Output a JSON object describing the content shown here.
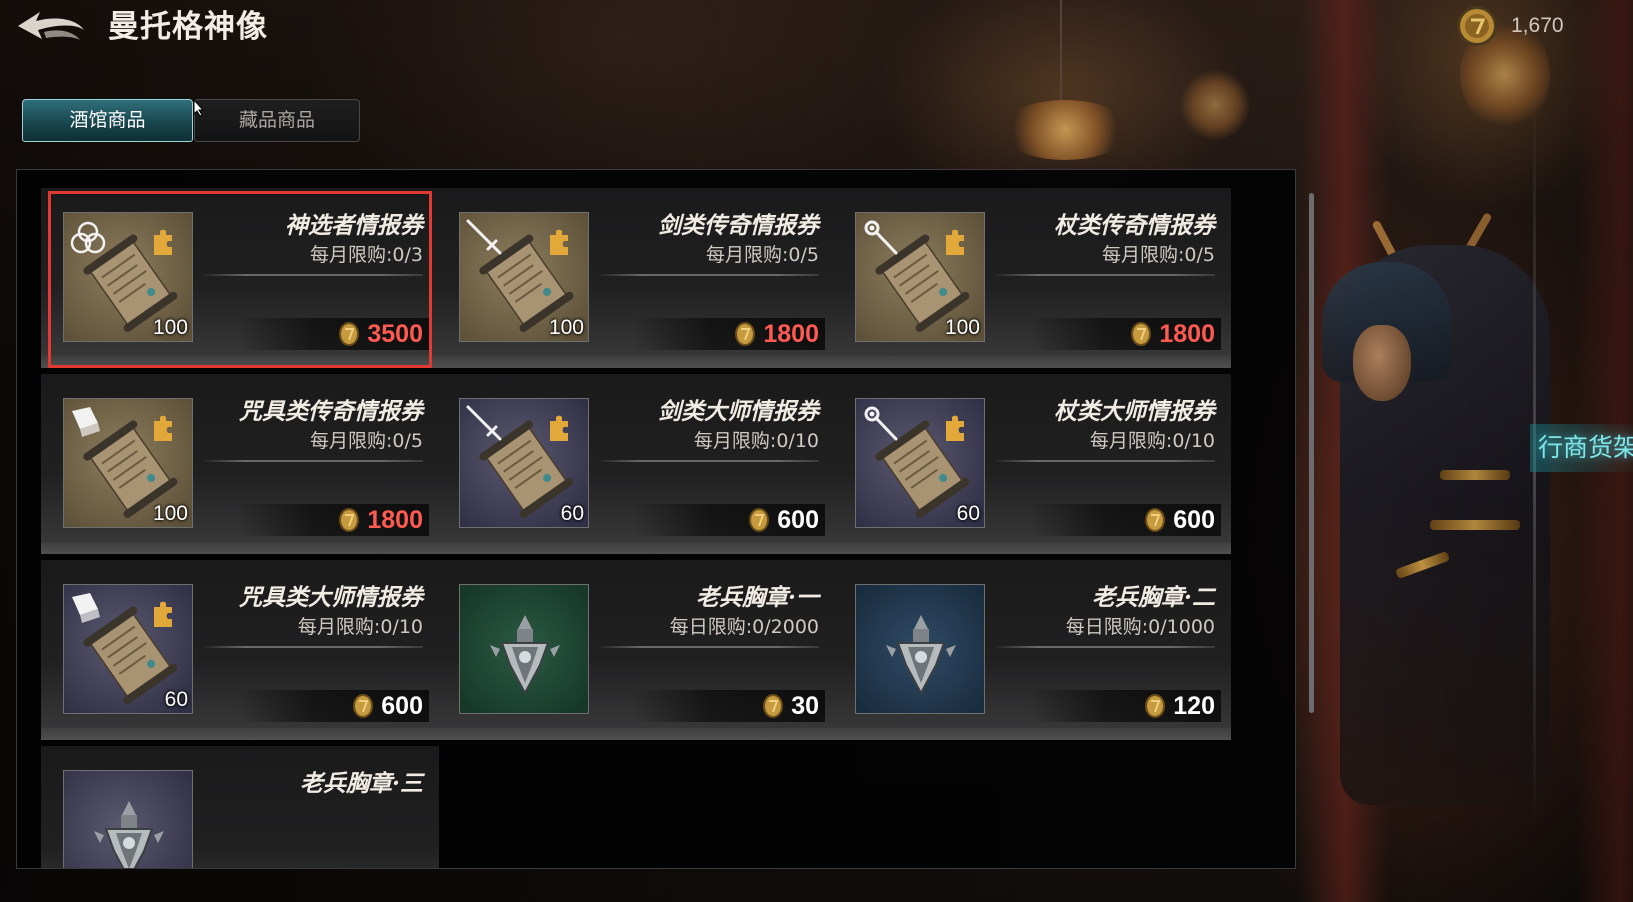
{
  "header": {
    "title": "曼托格神像",
    "back_icon": "back-arrow-icon",
    "currency_icon": "gold-coin-icon",
    "currency_amount": "1,670"
  },
  "tabs": [
    {
      "label": "酒馆商品",
      "active": true
    },
    {
      "label": "藏品商品",
      "active": false
    }
  ],
  "side_label": "行商货架",
  "accent_colors": {
    "tab_active": "#17434b",
    "selection_frame": "#e23a33",
    "price_expensive": "#ff5a52",
    "price_normal": "#ffffff",
    "side_label": "#7fe6ea"
  },
  "items": [
    {
      "name": "神选者情报券",
      "limit": "每月限购:0/3",
      "quantity": "100",
      "price": "3500",
      "price_style": "red",
      "thumb": "tan",
      "icon": "trinity-knot-icon",
      "selected": true
    },
    {
      "name": "剑类传奇情报券",
      "limit": "每月限购:0/5",
      "quantity": "100",
      "price": "1800",
      "price_style": "red",
      "thumb": "tan",
      "icon": "sword-icon",
      "selected": false
    },
    {
      "name": "杖类传奇情报券",
      "limit": "每月限购:0/5",
      "quantity": "100",
      "price": "1800",
      "price_style": "red",
      "thumb": "tan",
      "icon": "staff-icon",
      "selected": false
    },
    {
      "name": "咒具类传奇情报券",
      "limit": "每月限购:0/5",
      "quantity": "100",
      "price": "1800",
      "price_style": "red",
      "thumb": "tan",
      "icon": "tome-icon",
      "selected": false
    },
    {
      "name": "剑类大师情报券",
      "limit": "每月限购:0/10",
      "quantity": "60",
      "price": "600",
      "price_style": "white",
      "thumb": "purple",
      "icon": "sword-icon",
      "selected": false
    },
    {
      "name": "杖类大师情报券",
      "limit": "每月限购:0/10",
      "quantity": "60",
      "price": "600",
      "price_style": "white",
      "thumb": "purple",
      "icon": "staff-icon",
      "selected": false
    },
    {
      "name": "咒具类大师情报券",
      "limit": "每月限购:0/10",
      "quantity": "60",
      "price": "600",
      "price_style": "white",
      "thumb": "purple",
      "icon": "tome-icon",
      "selected": false
    },
    {
      "name": "老兵胸章·一",
      "limit": "每日限购:0/2000",
      "quantity": "",
      "price": "30",
      "price_style": "white",
      "thumb": "green",
      "icon": "medal-icon",
      "selected": false
    },
    {
      "name": "老兵胸章·二",
      "limit": "每日限购:0/1000",
      "quantity": "",
      "price": "120",
      "price_style": "white",
      "thumb": "blue",
      "icon": "medal-icon",
      "selected": false
    },
    {
      "name": "老兵胸章·三",
      "limit": "",
      "quantity": "",
      "price": "",
      "price_style": "white",
      "thumb": "purple",
      "icon": "medal-icon",
      "selected": false
    }
  ]
}
